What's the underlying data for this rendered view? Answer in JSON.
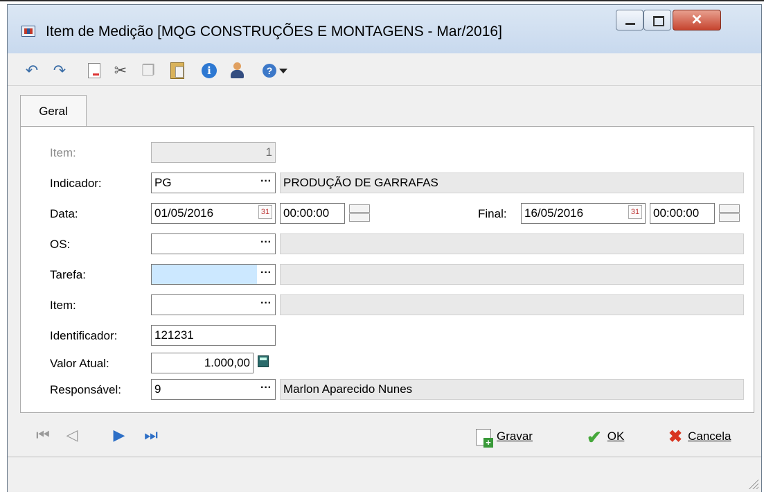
{
  "window": {
    "title": "Item de Medição [MQG CONSTRUÇÕES E MONTAGENS - Mar/2016]",
    "close_glyph": "✕"
  },
  "toolbar": {
    "icons": [
      "undo-icon",
      "redo-icon",
      "new-document-icon",
      "cut-icon",
      "copy-icon",
      "paste-icon",
      "info-icon",
      "user-icon",
      "help-icon"
    ],
    "info_glyph": "i",
    "help_glyph": "?"
  },
  "tabs": [
    {
      "label": "Geral"
    }
  ],
  "form": {
    "item": {
      "label": "Item:",
      "value": "1"
    },
    "indicador": {
      "label": "Indicador:",
      "code": "PG",
      "description": "PRODUÇÃO DE GARRAFAS"
    },
    "data": {
      "label": "Data:",
      "date": "01/05/2016",
      "time": "00:00:00"
    },
    "final": {
      "label": "Final:",
      "date": "16/05/2016",
      "time": "00:00:00"
    },
    "os": {
      "label": "OS:",
      "code": "",
      "description": ""
    },
    "tarefa": {
      "label": "Tarefa:",
      "code": "",
      "description": ""
    },
    "item2": {
      "label": "Item:",
      "code": "",
      "description": ""
    },
    "identificador": {
      "label": "Identificador:",
      "value": "121231"
    },
    "valor_atual": {
      "label": "Valor Atual:",
      "value": "1.000,00"
    },
    "responsavel": {
      "label": "Responsável:",
      "code": "9",
      "description": "Marlon Aparecido Nunes"
    },
    "lookup_glyph": "···",
    "calendar_glyph": "31"
  },
  "actions": {
    "gravar": "Gravar",
    "ok": "OK",
    "cancela": "Cancela"
  },
  "colors": {
    "window_bg": "#f0f0f0",
    "selected_field": "#cce8ff",
    "ok_green": "#46a83b",
    "cancel_red": "#d8341f",
    "nav_blue": "#2d6fc6"
  }
}
